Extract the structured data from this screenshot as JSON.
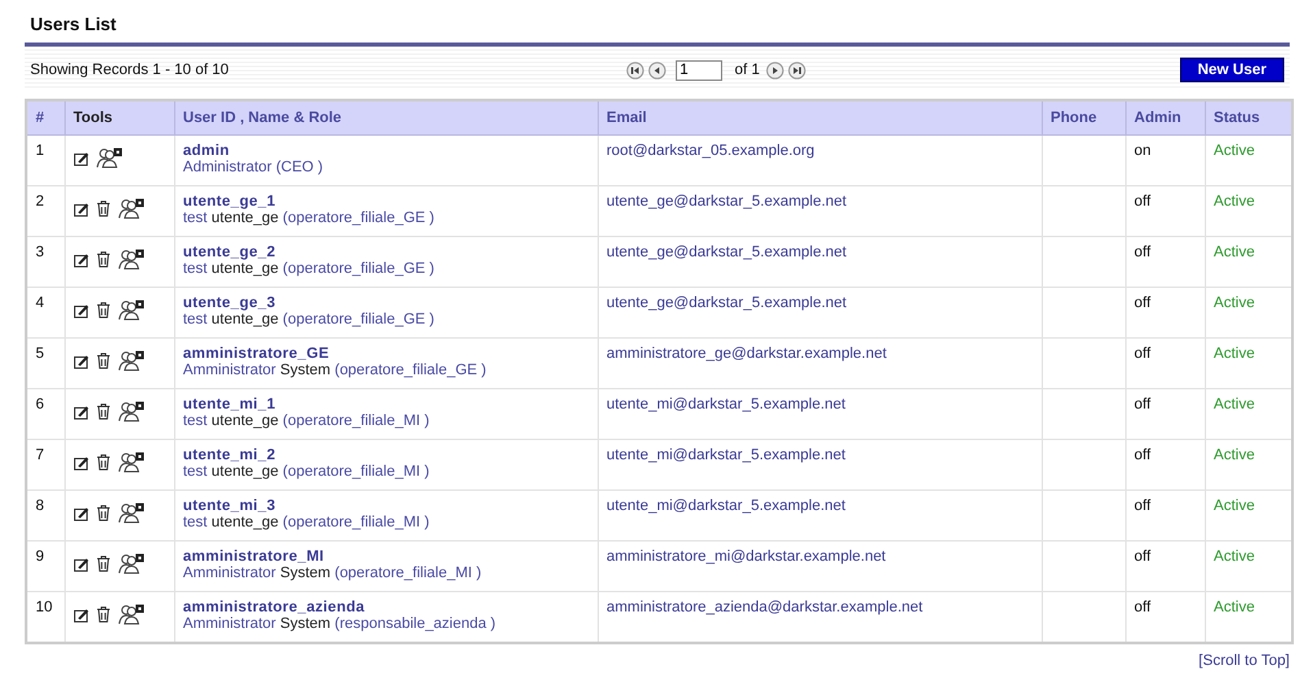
{
  "title": "Users List",
  "toolbar": {
    "records": "Showing Records 1 - 10 of 10",
    "page": "1",
    "of": "of 1",
    "new_button": "New User"
  },
  "table": {
    "columns": [
      "#",
      "Tools",
      "User ID , Name & Role",
      "Email",
      "Phone",
      "Admin",
      "Status"
    ],
    "rows": [
      {
        "num": "1",
        "tools": [
          {
            "kind": "edit"
          },
          {
            "kind": "roles"
          }
        ],
        "user_id": "admin",
        "first": "Administrator",
        "role": "(CEO )",
        "email": "root@darkstar_05.example.org",
        "admin": "on",
        "status": "Active"
      },
      {
        "num": "2",
        "tools": [
          {
            "kind": "edit"
          },
          {
            "kind": "delete"
          },
          {
            "kind": "roles"
          }
        ],
        "user_id": "utente_ge_1",
        "first": "test",
        "last": "utente_ge",
        "role": "(operatore_filiale_GE )",
        "email": "utente_ge@darkstar_5.example.net",
        "admin": "off",
        "status": "Active"
      },
      {
        "num": "3",
        "tools": [
          {
            "kind": "edit"
          },
          {
            "kind": "delete"
          },
          {
            "kind": "roles"
          }
        ],
        "user_id": "utente_ge_2",
        "first": "test",
        "last": "utente_ge",
        "role": "(operatore_filiale_GE )",
        "email": "utente_ge@darkstar_5.example.net",
        "admin": "off",
        "status": "Active"
      },
      {
        "num": "4",
        "tools": [
          {
            "kind": "edit"
          },
          {
            "kind": "delete"
          },
          {
            "kind": "roles"
          }
        ],
        "user_id": "utente_ge_3",
        "first": "test",
        "last": "utente_ge",
        "role": "(operatore_filiale_GE )",
        "email": "utente_ge@darkstar_5.example.net",
        "admin": "off",
        "status": "Active"
      },
      {
        "num": "5",
        "tools": [
          {
            "kind": "edit"
          },
          {
            "kind": "delete"
          },
          {
            "kind": "roles"
          }
        ],
        "user_id": "amministratore_GE",
        "first": "Amministrator",
        "last": "System",
        "role": "(operatore_filiale_GE )",
        "email": "amministratore_ge@darkstar.example.net",
        "admin": "off",
        "status": "Active"
      },
      {
        "num": "6",
        "tools": [
          {
            "kind": "edit"
          },
          {
            "kind": "delete"
          },
          {
            "kind": "roles"
          }
        ],
        "user_id": "utente_mi_1",
        "first": "test",
        "last": "utente_ge",
        "role": "(operatore_filiale_MI )",
        "email": "utente_mi@darkstar_5.example.net",
        "admin": "off",
        "status": "Active"
      },
      {
        "num": "7",
        "tools": [
          {
            "kind": "edit"
          },
          {
            "kind": "delete"
          },
          {
            "kind": "roles"
          }
        ],
        "user_id": "utente_mi_2",
        "first": "test",
        "last": "utente_ge",
        "role": "(operatore_filiale_MI )",
        "email": "utente_mi@darkstar_5.example.net",
        "admin": "off",
        "status": "Active"
      },
      {
        "num": "8",
        "tools": [
          {
            "kind": "edit"
          },
          {
            "kind": "delete"
          },
          {
            "kind": "roles"
          }
        ],
        "user_id": "utente_mi_3",
        "first": "test",
        "last": "utente_ge",
        "role": "(operatore_filiale_MI )",
        "email": "utente_mi@darkstar_5.example.net",
        "admin": "off",
        "status": "Active"
      },
      {
        "num": "9",
        "tools": [
          {
            "kind": "edit"
          },
          {
            "kind": "delete"
          },
          {
            "kind": "roles"
          }
        ],
        "user_id": "amministratore_MI",
        "first": "Amministrator",
        "last": "System",
        "role": "(operatore_filiale_MI )",
        "email": "amministratore_mi@darkstar.example.net",
        "admin": "off",
        "status": "Active"
      },
      {
        "num": "10",
        "tools": [
          {
            "kind": "edit"
          },
          {
            "kind": "delete"
          },
          {
            "kind": "roles"
          }
        ],
        "user_id": "amministratore_azienda",
        "first": "Amministrator",
        "last": "System",
        "role": "(responsabile_azienda )",
        "email": "amministratore_azienda@darkstar.example.net",
        "admin": "off",
        "status": "Active"
      }
    ]
  },
  "footer_link": "[Scroll to Top]"
}
